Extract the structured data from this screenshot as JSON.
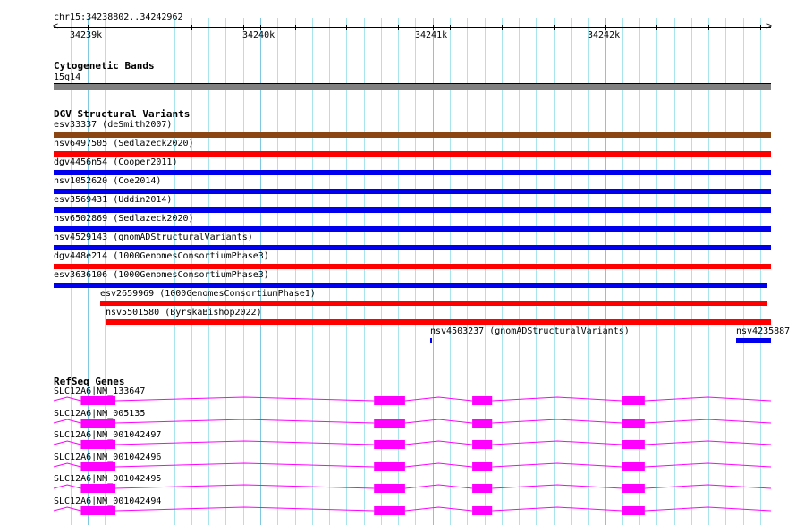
{
  "region": {
    "label": "chr15:34238802..34242962",
    "start": 34238802,
    "end": 34242962
  },
  "ruler": {
    "labels": [
      {
        "pos": 34239000,
        "text": "34239k"
      },
      {
        "pos": 34240000,
        "text": "34240k"
      },
      {
        "pos": 34241000,
        "text": "34241k"
      },
      {
        "pos": 34242000,
        "text": "34242k"
      }
    ]
  },
  "tracks": {
    "cyto": {
      "title": "Cytogenetic Bands",
      "band": "15q14",
      "color": "#808080"
    },
    "dgv": {
      "title": "DGV Structural Variants",
      "colors": {
        "brown": "#8b4513",
        "red": "#ff0000",
        "blue": "#0000ee"
      },
      "items": [
        {
          "label": "esv33337 (deSmith2007)",
          "color": "brown",
          "start": 34238802,
          "end": 34242962
        },
        {
          "label": "nsv6497505 (Sedlazeck2020)",
          "color": "red",
          "start": 34238802,
          "end": 34242962
        },
        {
          "label": "dgv4456n54 (Cooper2011)",
          "color": "blue",
          "start": 34238802,
          "end": 34242962
        },
        {
          "label": "nsv1052620 (Coe2014)",
          "color": "blue",
          "start": 34238802,
          "end": 34242962
        },
        {
          "label": "esv3569431 (Uddin2014)",
          "color": "blue",
          "start": 34238802,
          "end": 34242962
        },
        {
          "label": "nsv6502869 (Sedlazeck2020)",
          "color": "blue",
          "start": 34238802,
          "end": 34242962
        },
        {
          "label": "nsv4529143 (gnomADStructuralVariants)",
          "color": "blue",
          "start": 34238802,
          "end": 34242962
        },
        {
          "label": "dgv448e214 (1000GenomesConsortiumPhase3)",
          "color": "red",
          "start": 34238802,
          "end": 34242962
        },
        {
          "label": "esv3636106 (1000GenomesConsortiumPhase3)",
          "color": "blue",
          "start": 34238802,
          "end": 34242940
        },
        {
          "label": "esv2659969 (1000GenomesConsortiumPhase1)",
          "color": "red",
          "start": 34239070,
          "end": 34242940
        },
        {
          "label": "nsv5501580 (ByrskaBishop2022)",
          "color": "red",
          "start": 34239105,
          "end": 34242962
        },
        {
          "label": "nsv4503237 (gnomADStructuralVariants)",
          "color": "blue",
          "start": 34240985,
          "end": 34240995
        },
        {
          "label": "nsv4235887",
          "color": "blue",
          "start": 34242760,
          "end": 34242962
        }
      ]
    },
    "refseq": {
      "title": "RefSeq Genes",
      "color": "#ff00ff",
      "exons": [
        [
          34238960,
          34239160
        ],
        [
          34240660,
          34240840
        ],
        [
          34241230,
          34241345
        ],
        [
          34242100,
          34242230
        ]
      ],
      "items": [
        "SLC12A6|NM_133647",
        "SLC12A6|NM_005135",
        "SLC12A6|NM_001042497",
        "SLC12A6|NM_001042496",
        "SLC12A6|NM_001042495",
        "SLC12A6|NM_001042494"
      ]
    }
  }
}
